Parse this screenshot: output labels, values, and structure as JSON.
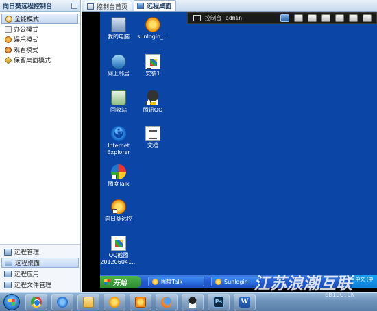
{
  "sidebar": {
    "title": "向日葵远程控制台",
    "modes": [
      {
        "label": "全能模式",
        "icon": "all-mode-icon",
        "active": true
      },
      {
        "label": "办公模式",
        "icon": "office-mode-icon",
        "active": false
      },
      {
        "label": "娱乐模式",
        "icon": "entertainment-mode-icon",
        "active": false
      },
      {
        "label": "观看模式",
        "icon": "watch-mode-icon",
        "active": false
      },
      {
        "label": "保留桌面模式",
        "icon": "keep-desktop-mode-icon",
        "active": false
      }
    ],
    "bottom_items": [
      {
        "label": "远程管理",
        "icon": "remote-manage-icon",
        "active": false
      },
      {
        "label": "远程桌面",
        "icon": "remote-desktop-icon",
        "active": true
      },
      {
        "label": "远程应用",
        "icon": "remote-app-icon",
        "active": false
      },
      {
        "label": "远程文件管理",
        "icon": "remote-file-icon",
        "active": false
      }
    ]
  },
  "tabs": [
    {
      "label": "控制台首页",
      "active": false
    },
    {
      "label": "远程桌面",
      "active": true
    }
  ],
  "control_bar": {
    "title": "控制台",
    "user": "admin"
  },
  "desktop_icons": [
    {
      "label": "我的电脑",
      "icon": "my-computer-icon"
    },
    {
      "label": "sunlogin_...",
      "icon": "sunlogin-icon"
    },
    {
      "label": "网上邻居",
      "icon": "network-places-icon"
    },
    {
      "label": "安装1",
      "icon": "installer-icon"
    },
    {
      "label": "回收站",
      "icon": "recycle-bin-icon"
    },
    {
      "label": "腾讯QQ",
      "icon": "qq-icon"
    },
    {
      "label": "Internet Explorer",
      "icon": "internet-explorer-icon"
    },
    {
      "label": "文档",
      "icon": "document-icon"
    },
    {
      "label": "图度Talk",
      "icon": "tudu-talk-icon"
    },
    {
      "label": "向日葵远控",
      "icon": "sunflower-remote-icon"
    },
    {
      "label": "QQ截图 201206041...",
      "icon": "qq-screenshot-icon"
    }
  ],
  "xp_taskbar": {
    "start_label": "开始",
    "tasks": [
      {
        "label": "图度Talk"
      },
      {
        "label": "Sunlogin"
      }
    ],
    "tray_text": "中文 (中"
  },
  "win7_taskbar": {
    "items": [
      "chrome-icon",
      "internet-explorer-icon",
      "folder-icon",
      "sunflower-icon",
      "sunlogin-remote-icon",
      "firefox-icon",
      "qq-icon",
      "photoshop-icon",
      "word-icon"
    ],
    "ps_text": "Ps",
    "word_text": "W"
  },
  "watermark": {
    "title": "江苏浪潮互联",
    "sub": "6BIDC.CN"
  }
}
